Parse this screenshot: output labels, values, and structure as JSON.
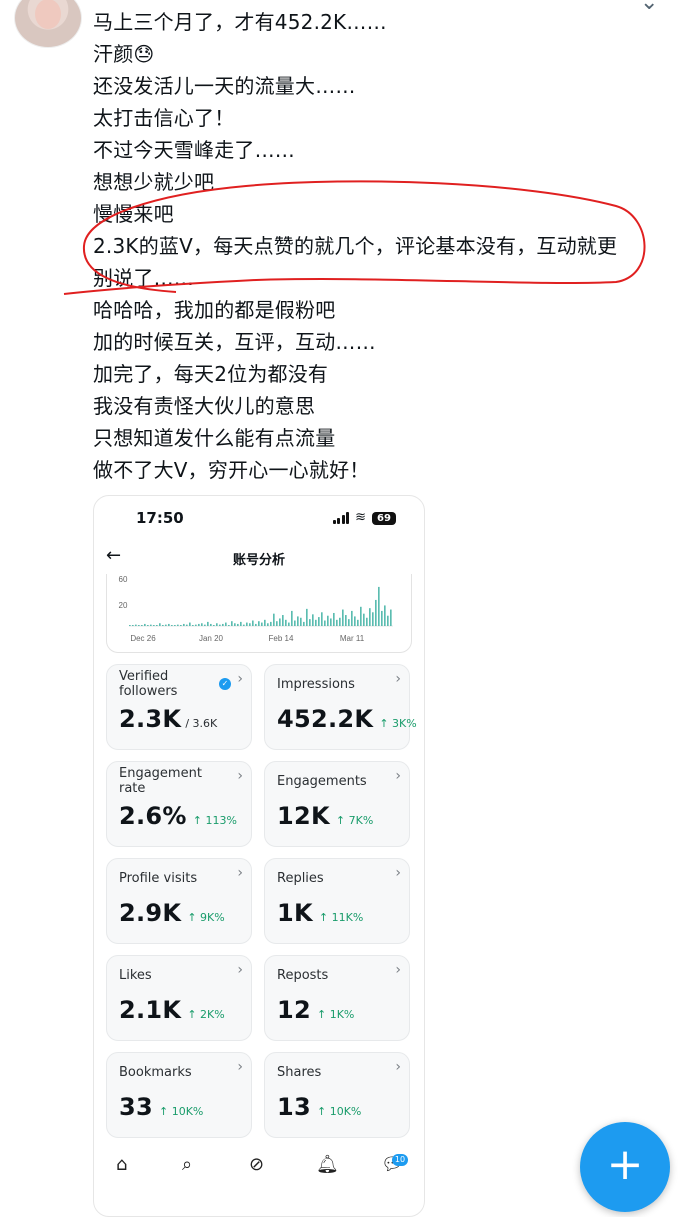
{
  "post": {
    "lines": [
      "马上三个月了，才有452.2K……",
      "汗颜😓",
      "还没发活儿一天的流量大……",
      "太打击信心了！",
      "不过今天雪峰走了……",
      "想想少就少吧",
      "慢慢来吧",
      "2.3K的蓝V，每天点赞的就几个，评论基本没有，互动就更",
      "别说了……",
      "哈哈哈，我加的都是假粉吧",
      "加的时候互关，互评，互动……",
      "加完了，每天2位为都没有",
      "我没有责怪大伙儿的意思",
      "只想知道发什么能有点流量",
      "做不了大V，穷开心一心就好！"
    ],
    "annotation_color": "#e02020"
  },
  "phone": {
    "status": {
      "time": "17:50",
      "battery": "69"
    },
    "nav_title": "账号分析",
    "chart_data": {
      "type": "bar",
      "y_ticks": [
        "60",
        "20"
      ],
      "x_ticks": [
        "Dec 26",
        "Jan 20",
        "Feb 14",
        "Mar 11"
      ],
      "ylim": [
        0,
        70
      ],
      "bar_color": "#5bbcb0",
      "values": [
        1,
        0,
        2,
        1,
        0,
        3,
        1,
        2,
        0,
        1,
        4,
        1,
        2,
        3,
        1,
        0,
        2,
        1,
        3,
        2,
        5,
        1,
        2,
        3,
        4,
        2,
        6,
        3,
        1,
        4,
        2,
        3,
        5,
        1,
        7,
        4,
        3,
        6,
        2,
        5,
        4,
        8,
        3,
        7,
        5,
        9,
        4,
        6,
        18,
        7,
        11,
        16,
        9,
        5,
        22,
        8,
        14,
        12,
        6,
        25,
        10,
        17,
        9,
        13,
        20,
        8,
        15,
        11,
        19,
        9,
        12,
        24,
        16,
        10,
        22,
        14,
        9,
        28,
        18,
        12,
        26,
        20,
        38,
        57,
        22,
        30,
        15,
        24
      ]
    },
    "cards": [
      {
        "label": "Verified followers",
        "value": "2.3K",
        "sub": "/ 3.6K",
        "delta": "",
        "verified": true
      },
      {
        "label": "Impressions",
        "value": "452.2K",
        "sub": "",
        "delta": "↑ 3K%",
        "verified": false
      },
      {
        "label": "Engagement rate",
        "value": "2.6%",
        "sub": "",
        "delta": "↑ 113%",
        "verified": false
      },
      {
        "label": "Engagements",
        "value": "12K",
        "sub": "",
        "delta": "↑ 7K%",
        "verified": false
      },
      {
        "label": "Profile visits",
        "value": "2.9K",
        "sub": "",
        "delta": "↑ 9K%",
        "verified": false
      },
      {
        "label": "Replies",
        "value": "1K",
        "sub": "",
        "delta": "↑ 11K%",
        "verified": false
      },
      {
        "label": "Likes",
        "value": "2.1K",
        "sub": "",
        "delta": "↑ 2K%",
        "verified": false
      },
      {
        "label": "Reposts",
        "value": "12",
        "sub": "",
        "delta": "↑ 1K%",
        "verified": false
      },
      {
        "label": "Bookmarks",
        "value": "33",
        "sub": "",
        "delta": "↑ 10K%",
        "verified": false
      },
      {
        "label": "Shares",
        "value": "13",
        "sub": "",
        "delta": "↑ 10K%",
        "verified": false
      }
    ],
    "messages_badge": "10",
    "tabs": [
      "home-icon",
      "search-icon",
      "grok-icon",
      "notifications-icon",
      "messages-icon"
    ]
  },
  "compose": {
    "icon": "+"
  },
  "accent": "#1d9bf0"
}
